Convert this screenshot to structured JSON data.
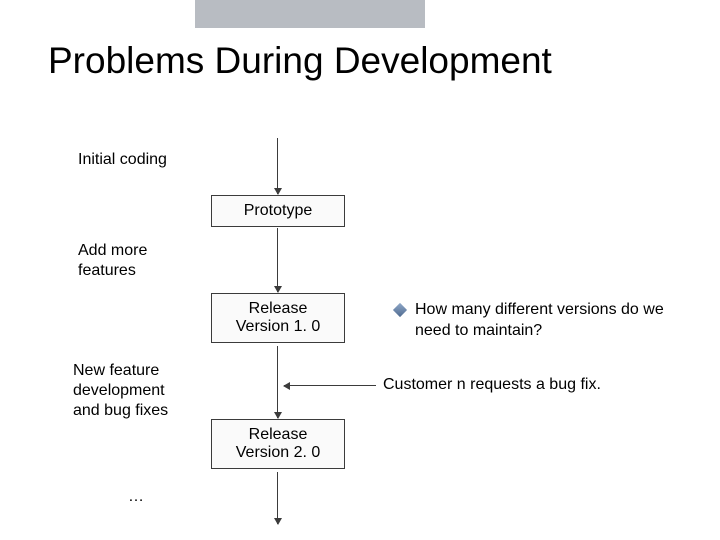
{
  "title": "Problems During Development",
  "labels": {
    "initial": "Initial coding",
    "addmore": "Add more\nfeatures",
    "newfeature": "New feature\ndevelopment\nand bug fixes",
    "ellipsis": "…"
  },
  "boxes": {
    "prototype": "Prototype",
    "release1": "Release\nVersion 1. 0",
    "release2": "Release\nVersion 2. 0"
  },
  "bullet": "How many different versions do we need to maintain?",
  "request": "Customer n requests a bug fix."
}
